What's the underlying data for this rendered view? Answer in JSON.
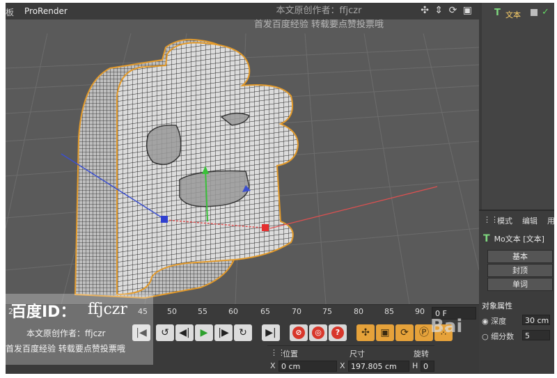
{
  "viewport": {
    "menu_left": "板",
    "menu_pro": "ProRender"
  },
  "object_manager": {
    "object_name": "文本"
  },
  "attributes": {
    "menu": [
      "模式",
      "编辑",
      "用"
    ],
    "object_line": "Mo文本 [文本]",
    "tabs": [
      "基本",
      "封顶",
      "单词"
    ],
    "section": "对象属性",
    "depth_label": "深度",
    "depth_value": "30 cm",
    "subdiv_label": "细分数",
    "subdiv_value": "5"
  },
  "timeline": {
    "ticks": [
      "45",
      "50",
      "55",
      "60",
      "65",
      "70",
      "75",
      "80",
      "85",
      "90"
    ],
    "left_tick": "2",
    "frame": "0 F"
  },
  "coordinates": {
    "position_label": "位置",
    "size_label": "尺寸",
    "rotation_label": "旋转",
    "x_label": "X",
    "x_value": "0 cm",
    "size_x_label": "X",
    "size_x_value": "197.805 cm",
    "h_label": "H",
    "h_value": "0"
  },
  "watermarks": {
    "top_line1": "本文原创作者：ffjczr",
    "top_line2": "首发百度经验  转载要点赞投票哦",
    "baidu_id": "百度ID：",
    "uid": "ffjczr",
    "line1": "本文原创作者：ffjczr",
    "line2": "首发百度经验  转载要点赞投票哦"
  },
  "colors": {
    "accent_orange": "#e6a23a",
    "record_red": "#d8372b",
    "text_icon_green": "#7fd97f"
  }
}
